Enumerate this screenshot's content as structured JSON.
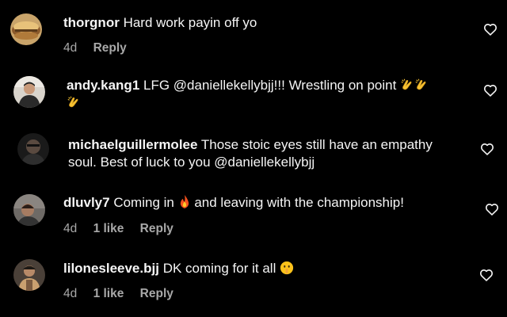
{
  "comments": [
    {
      "username": "thorgnor",
      "text": "Hard work payin off yo",
      "time": "4d",
      "likes": "",
      "reply_label": "Reply"
    },
    {
      "username": "andy.kang1",
      "text": "LFG @daniellekellybjj!!! Wrestling on point",
      "emoji": "clapping-hands-x3",
      "time": "",
      "likes": "",
      "reply_label": ""
    },
    {
      "username": "michaelguillermolee",
      "text": "Those stoic eyes still have an empathy soul. Best of luck to you @daniellekellybjj",
      "time": "",
      "likes": "",
      "reply_label": ""
    },
    {
      "username": "dluvly7",
      "text_before": "Coming in",
      "emoji": "fire",
      "text_after": "and leaving with the championship!",
      "time": "4d",
      "likes": "1 like",
      "reply_label": "Reply"
    },
    {
      "username": "lilonesleeve.bjj",
      "text": "DK coming for it all",
      "emoji": "shushing-face",
      "time": "4d",
      "likes": "1 like",
      "reply_label": "Reply"
    }
  ],
  "colors": {
    "background": "#000000",
    "text": "#f5f5f5",
    "meta": "#a8a8a8"
  }
}
